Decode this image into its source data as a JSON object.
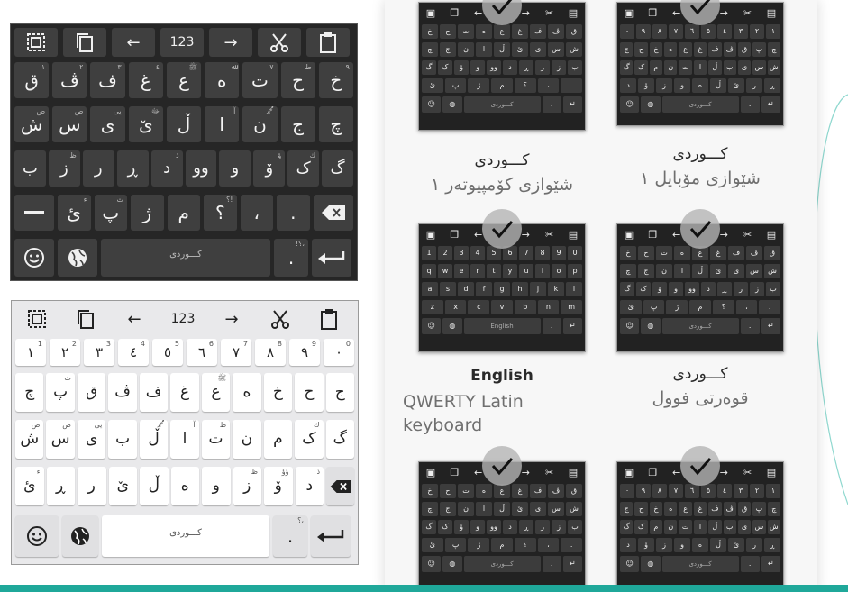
{
  "toolbar": {
    "items": [
      {
        "icon": "select-all-icon",
        "label": ""
      },
      {
        "icon": "copy-icon",
        "label": ""
      },
      {
        "icon": "arrow-left-icon",
        "label": "←"
      },
      {
        "icon": "",
        "label": "123"
      },
      {
        "icon": "arrow-right-icon",
        "label": "→"
      },
      {
        "icon": "cut-icon",
        "label": ""
      },
      {
        "icon": "paste-icon",
        "label": ""
      }
    ]
  },
  "dark_keyboard": {
    "row1": [
      {
        "main": "ق",
        "hint": "١"
      },
      {
        "main": "ڤ",
        "hint": "٢"
      },
      {
        "main": "ف",
        "hint": "٣"
      },
      {
        "main": "غ",
        "hint": "٤"
      },
      {
        "main": "ع",
        "hint": "ﷺ"
      },
      {
        "main": "ه",
        "hint": "ﷲ"
      },
      {
        "main": "ت",
        "hint": "٧"
      },
      {
        "main": "ح",
        "hint": "ط"
      },
      {
        "main": "خ",
        "hint": "٩"
      }
    ],
    "row2": [
      {
        "main": "ش",
        "hint": "ض"
      },
      {
        "main": "س",
        "hint": "ص"
      },
      {
        "main": "ی",
        "hint": "يى"
      },
      {
        "main": "ێ",
        "hint": "ﷻ"
      },
      {
        "main": "ڵ",
        "hint": ""
      },
      {
        "main": "ا",
        "hint": "آ"
      },
      {
        "main": "ن",
        "hint": "ﷴ"
      },
      {
        "main": "ج",
        "hint": ""
      },
      {
        "main": "چ",
        "hint": ""
      }
    ],
    "row3": [
      {
        "main": "ب",
        "hint": ""
      },
      {
        "main": "ز",
        "hint": "ظ"
      },
      {
        "main": "ر",
        "hint": ""
      },
      {
        "main": "ڕ",
        "hint": ""
      },
      {
        "main": "د",
        "hint": "ذ"
      },
      {
        "main": "وو",
        "hint": ""
      },
      {
        "main": "و",
        "hint": ""
      },
      {
        "main": "ۆ",
        "hint": "ؤ"
      },
      {
        "main": "ک",
        "hint": "ك"
      },
      {
        "main": "گ",
        "hint": ""
      }
    ],
    "row4": [
      {
        "main": "ئ",
        "hint": "ء"
      },
      {
        "main": "پ",
        "hint": "ث"
      },
      {
        "main": "ژ",
        "hint": ""
      },
      {
        "main": "م",
        "hint": ""
      },
      {
        "main": "؟",
        "hint": "؟!"
      },
      {
        "main": "،",
        "hint": ""
      },
      {
        "main": ".",
        "hint": ""
      }
    ],
    "space_label": "کـــوردی",
    "period_hint": "!؟،"
  },
  "light_keyboard": {
    "row1": [
      {
        "main": "١",
        "hint": "1"
      },
      {
        "main": "٢",
        "hint": "2"
      },
      {
        "main": "٣",
        "hint": "3"
      },
      {
        "main": "٤",
        "hint": "4"
      },
      {
        "main": "٥",
        "hint": "5"
      },
      {
        "main": "٦",
        "hint": "6"
      },
      {
        "main": "٧",
        "hint": "7"
      },
      {
        "main": "٨",
        "hint": "8"
      },
      {
        "main": "٩",
        "hint": "9"
      },
      {
        "main": "٠",
        "hint": "0"
      }
    ],
    "row2": [
      {
        "main": "چ",
        "hint": ""
      },
      {
        "main": "پ",
        "hint": "ث"
      },
      {
        "main": "ق",
        "hint": ""
      },
      {
        "main": "ڤ",
        "hint": ""
      },
      {
        "main": "ف",
        "hint": ""
      },
      {
        "main": "غ",
        "hint": ""
      },
      {
        "main": "ع",
        "hint": "ﷺ"
      },
      {
        "main": "ه",
        "hint": ""
      },
      {
        "main": "خ",
        "hint": ""
      },
      {
        "main": "ح",
        "hint": ""
      },
      {
        "main": "ج",
        "hint": ""
      }
    ],
    "row3": [
      {
        "main": "ش",
        "hint": "ض"
      },
      {
        "main": "س",
        "hint": "ص"
      },
      {
        "main": "ی",
        "hint": "يى"
      },
      {
        "main": "ب",
        "hint": ""
      },
      {
        "main": "ڵ",
        "hint": "ﷴ"
      },
      {
        "main": "ا",
        "hint": "آ"
      },
      {
        "main": "ت",
        "hint": "ط"
      },
      {
        "main": "ن",
        "hint": ""
      },
      {
        "main": "م",
        "hint": ""
      },
      {
        "main": "ک",
        "hint": "ك"
      },
      {
        "main": "گ",
        "hint": ""
      }
    ],
    "row4": [
      {
        "main": "ئ",
        "hint": "ء"
      },
      {
        "main": "ڕ",
        "hint": ""
      },
      {
        "main": "ر",
        "hint": ""
      },
      {
        "main": "ێ",
        "hint": ""
      },
      {
        "main": "ڵ",
        "hint": ""
      },
      {
        "main": "ه",
        "hint": ""
      },
      {
        "main": "و",
        "hint": ""
      },
      {
        "main": "ز",
        "hint": "ظ"
      },
      {
        "main": "ۆ",
        "hint": "ؤؤ"
      },
      {
        "main": "د",
        "hint": "ذ"
      }
    ],
    "space_label": "کـــوردی",
    "period_hint": "!؟،"
  },
  "options": [
    {
      "title": "کـــوردی",
      "subtitle": "شێوازی کۆمپیوتەر ١",
      "selected": true,
      "space": "کـــوردی"
    },
    {
      "title": "کـــوردی",
      "subtitle": "شێوازی مۆبایل ١",
      "selected": true,
      "space": "کـــوردی"
    },
    {
      "title": "English",
      "subtitle": "QWERTY Latin keyboard",
      "selected": true,
      "space": "English"
    },
    {
      "title": "کـــوردی",
      "subtitle": "قوەرتی فوول",
      "selected": true,
      "space": "کـــوردی"
    },
    {
      "title": "",
      "subtitle": "",
      "selected": true,
      "space": "کـــوردی"
    },
    {
      "title": "",
      "subtitle": "",
      "selected": true,
      "space": "کـــوردی"
    }
  ],
  "mini_keys": {
    "arabic_rows": [
      [
        "خ",
        "ح",
        "ت",
        "ه",
        "ع",
        "غ",
        "ف",
        "ڤ",
        "ق"
      ],
      [
        "چ",
        "ج",
        "ن",
        "ا",
        "ڵ",
        "ێ",
        "ی",
        "س",
        "ش"
      ],
      [
        "گ",
        "ک",
        "ۆ",
        "و",
        "وو",
        "د",
        "ڕ",
        "ر",
        "ز",
        "ب"
      ],
      [
        "ئ",
        "پ",
        "ژ",
        "م",
        "؟",
        "،",
        "."
      ]
    ],
    "mobile_rows": [
      [
        "٠",
        "٩",
        "٨",
        "٧",
        "٦",
        "٥",
        "٤",
        "٣",
        "٢",
        "١"
      ],
      [
        "ج",
        "ح",
        "خ",
        "ه",
        "ع",
        "غ",
        "ف",
        "ڤ",
        "ق",
        "پ",
        "چ"
      ],
      [
        "گ",
        "ک",
        "م",
        "ن",
        "ت",
        "ا",
        "ڵ",
        "ب",
        "ی",
        "س",
        "ش"
      ],
      [
        "د",
        "ۆ",
        "ز",
        "و",
        "ه",
        "ڵ",
        "ێ",
        "ر",
        "ڕ"
      ]
    ],
    "english_rows": [
      [
        "1",
        "2",
        "3",
        "4",
        "5",
        "6",
        "7",
        "8",
        "9",
        "0"
      ],
      [
        "q",
        "w",
        "e",
        "r",
        "t",
        "y",
        "u",
        "i",
        "o",
        "p"
      ],
      [
        "a",
        "s",
        "d",
        "f",
        "g",
        "h",
        "j",
        "k",
        "l"
      ],
      [
        "z",
        "x",
        "c",
        "v",
        "b",
        "n",
        "m"
      ]
    ]
  },
  "colors": {
    "dark_bg": "#262626",
    "dark_key": "#3f3f3f",
    "light_bg": "#e9e9eb",
    "accent": "#1fa89a"
  }
}
